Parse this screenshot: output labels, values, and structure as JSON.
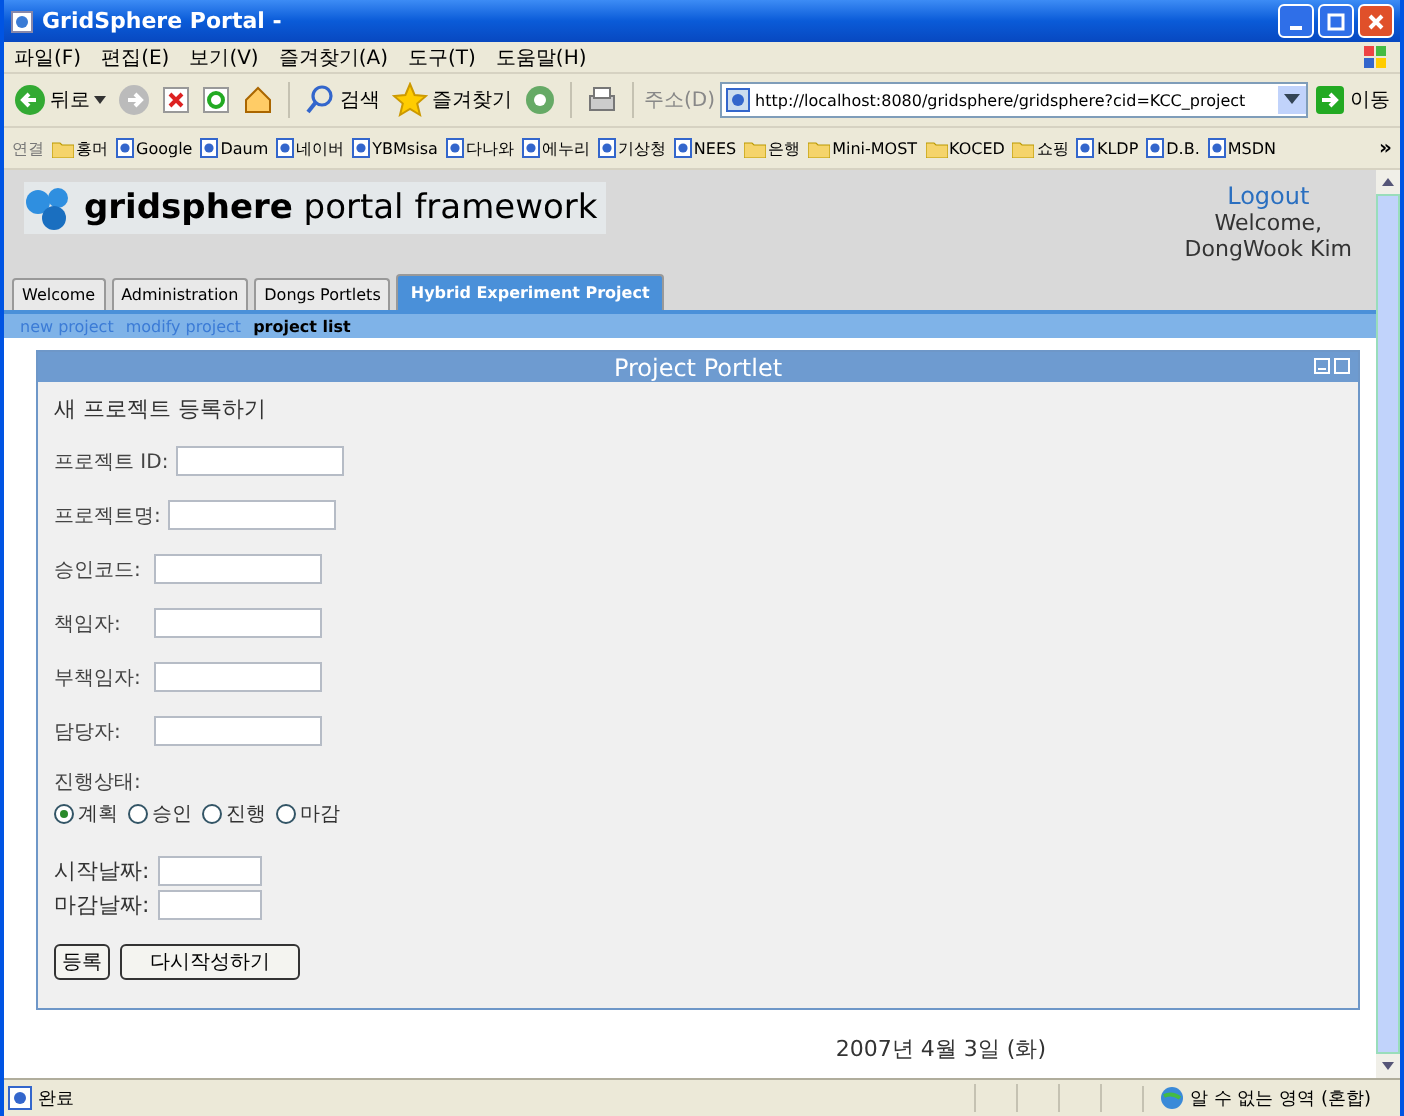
{
  "window": {
    "title": "GridSphere Portal -"
  },
  "menu": [
    "파일(F)",
    "편집(E)",
    "보기(V)",
    "즐겨찾기(A)",
    "도구(T)",
    "도움말(H)"
  ],
  "toolbar": {
    "back": "뒤로",
    "search": "검색",
    "favorites": "즐겨찾기",
    "address_label": "주소(D)",
    "url": "http://localhost:8080/gridsphere/gridsphere?cid=KCC_project",
    "go": "이동"
  },
  "links": {
    "label": "연결",
    "items": [
      {
        "kind": "folder",
        "label": "홍머"
      },
      {
        "kind": "page",
        "label": "Google"
      },
      {
        "kind": "page",
        "label": "Daum"
      },
      {
        "kind": "page",
        "label": "네이버"
      },
      {
        "kind": "page",
        "label": "YBMsisa"
      },
      {
        "kind": "page",
        "label": "다나와"
      },
      {
        "kind": "page",
        "label": "에누리"
      },
      {
        "kind": "page",
        "label": "기상청"
      },
      {
        "kind": "page",
        "label": "NEES"
      },
      {
        "kind": "folder",
        "label": "은행"
      },
      {
        "kind": "folder",
        "label": "Mini-MOST"
      },
      {
        "kind": "folder",
        "label": "KOCED"
      },
      {
        "kind": "folder",
        "label": "쇼핑"
      },
      {
        "kind": "page",
        "label": "KLDP"
      },
      {
        "kind": "page",
        "label": "D.B."
      },
      {
        "kind": "page",
        "label": "MSDN"
      }
    ],
    "more": "»"
  },
  "portal": {
    "logo_bold": "gridsphere",
    "logo_rest": "portal framework",
    "logout": "Logout",
    "welcome": "Welcome,",
    "user": "DongWook Kim"
  },
  "tabs": [
    {
      "label": "Welcome",
      "selected": false
    },
    {
      "label": "Administration",
      "selected": false
    },
    {
      "label": "Dongs Portlets",
      "selected": false
    },
    {
      "label": "Hybrid Experiment Project",
      "selected": true
    }
  ],
  "subnav": [
    {
      "label": "new project",
      "selected": false
    },
    {
      "label": "modify project",
      "selected": false
    },
    {
      "label": "project list",
      "selected": true
    }
  ],
  "portlet": {
    "title": "Project Portlet",
    "heading": "새 프로젝트 등록하기",
    "fields": [
      {
        "label": "프로젝트 ID:"
      },
      {
        "label": "프로젝트명:"
      },
      {
        "label": "승인코드:"
      },
      {
        "label": "책임자:"
      },
      {
        "label": "부책임자:"
      },
      {
        "label": "담당자:"
      }
    ],
    "status_label": "진행상태:",
    "status_options": [
      {
        "label": "계획",
        "selected": true
      },
      {
        "label": "승인",
        "selected": false
      },
      {
        "label": "진행",
        "selected": false
      },
      {
        "label": "마감",
        "selected": false
      }
    ],
    "dates": [
      {
        "label": "시작날짜:"
      },
      {
        "label": "마감날짜:"
      }
    ],
    "buttons": [
      "등록",
      "다시작성하기"
    ]
  },
  "date": "2007년 4월 3일 (화)",
  "status_bar": {
    "text": "완료",
    "zone": "알 수 없는 영역 (혼합)"
  }
}
